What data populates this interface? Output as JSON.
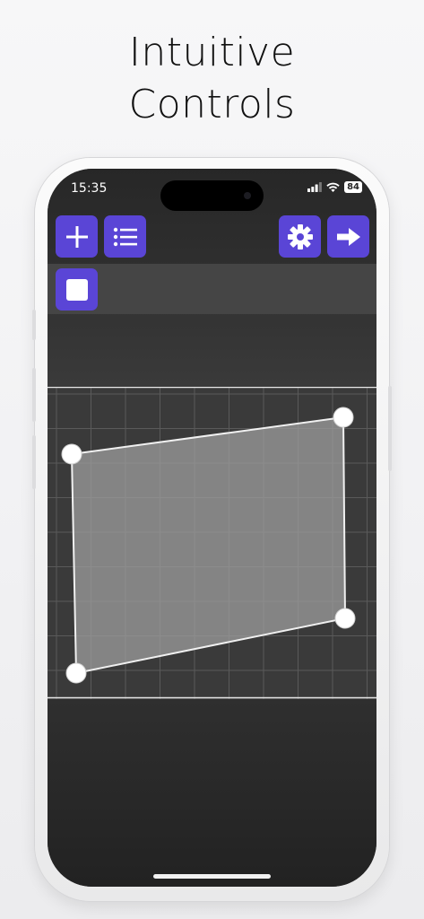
{
  "headline": {
    "line1": "Intuitive",
    "line2": "Controls"
  },
  "status_bar": {
    "time": "15:35",
    "battery": "84"
  },
  "toolbar": {
    "buttons_left": [
      "plus-icon",
      "list-icon"
    ],
    "buttons_right": [
      "gear-icon",
      "arrow-right-icon"
    ],
    "accent": "#5a45d6"
  },
  "secondary_toolbar": {
    "buttons": [
      "square-icon"
    ]
  },
  "canvas": {
    "grid_color": "#5a5a5a",
    "shape_fill": "#9a9a9a",
    "handle_color": "#ffffff"
  }
}
